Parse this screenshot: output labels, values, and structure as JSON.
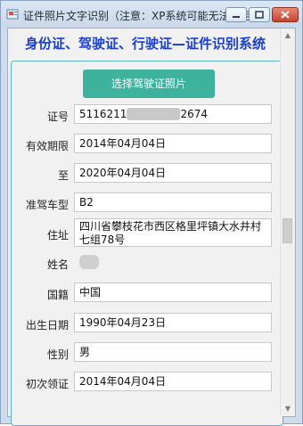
{
  "window": {
    "title": "证件照片文字识别（注意：XP系统可能无法使用）",
    "icons": {
      "app": "app-icon",
      "minimize": "minimize-icon",
      "maximize": "maximize-icon",
      "close": "close-icon"
    }
  },
  "header": {
    "title": "身份证、驾驶证、行驶证—证件识别系统"
  },
  "actions": {
    "select_photo": "选择驾驶证照片"
  },
  "fields": {
    "cert_no": {
      "label": "证号",
      "prefix": "5116211",
      "suffix": "2674"
    },
    "valid_period": {
      "label": "有效期限",
      "value": "2014年04月04日"
    },
    "valid_to": {
      "label": "至",
      "value": "2020年04月04日"
    },
    "vehicle_class": {
      "label": "准驾车型",
      "value": "B2"
    },
    "address": {
      "label": "住址",
      "value": "四川省攀枝花市西区格里坪镇大水井村七组78号"
    },
    "name": {
      "label": "姓名",
      "value": ""
    },
    "nationality": {
      "label": "国籍",
      "value": "中国"
    },
    "birth_date": {
      "label": "出生日期",
      "value": "1990年04月23日"
    },
    "gender": {
      "label": "性别",
      "value": "男"
    },
    "first_issue": {
      "label": "初次领证",
      "value": "2014年04月04日"
    }
  },
  "colors": {
    "accent": "#3db39e",
    "header_text": "#1a3fd0",
    "panel_border": "#5fb3c7"
  }
}
